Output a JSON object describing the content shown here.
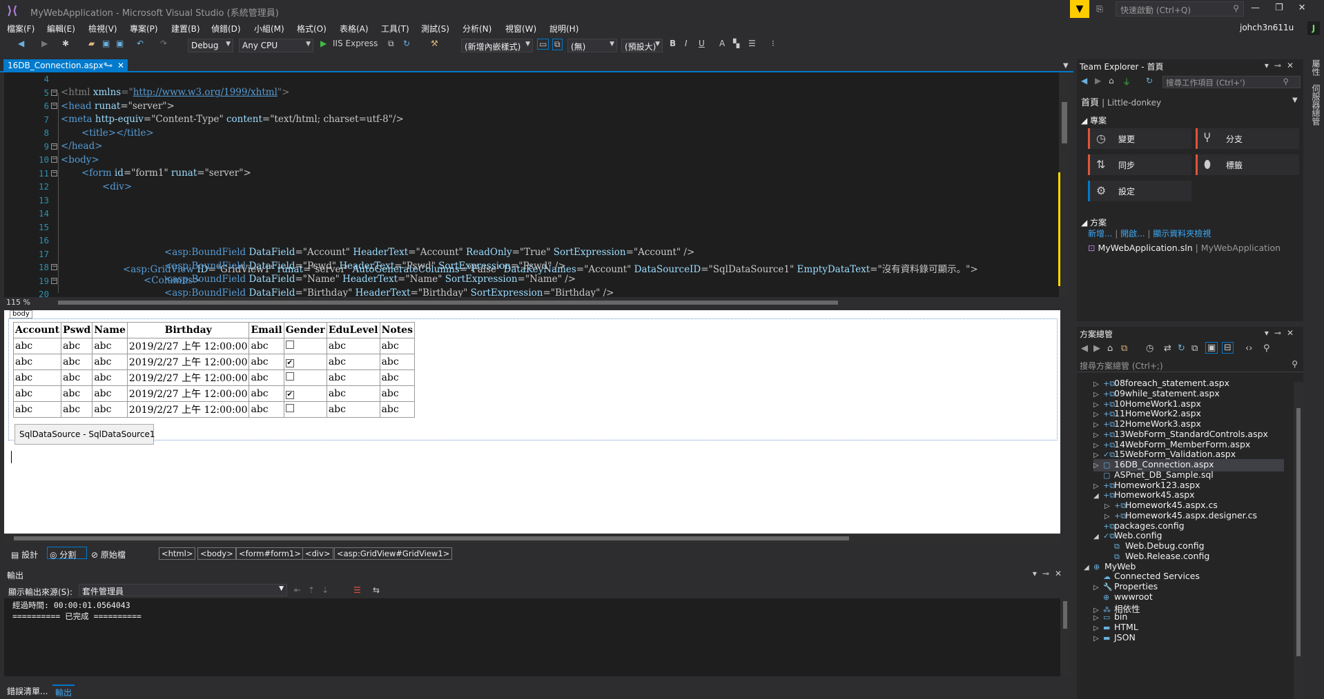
{
  "window": {
    "title": "MyWebApplication - Microsoft Visual Studio (系統管理員)",
    "quick_launch_placeholder": "快速啟動 (Ctrl+Q)",
    "user": "johch3n611u",
    "user_initial": "J"
  },
  "menu": [
    "檔案(F)",
    "編輯(E)",
    "檢視(V)",
    "專案(P)",
    "建置(B)",
    "偵錯(D)",
    "小組(M)",
    "格式(O)",
    "表格(A)",
    "工具(T)",
    "測試(S)",
    "分析(N)",
    "視窗(W)",
    "說明(H)"
  ],
  "toolbar": {
    "config": "Debug",
    "platform": "Any CPU",
    "run_label": "IIS Express",
    "style_combo": "(新增內嵌樣式)",
    "style_target": "(無)",
    "font_size": "(預設大)",
    "bold": "B",
    "italic": "I",
    "underline": "U"
  },
  "doc_tab": {
    "label": "16DB_Connection.aspx*"
  },
  "editor": {
    "zoom": "115 %",
    "line_numbers": [
      "4",
      "5",
      "6",
      "7",
      "8",
      "9",
      "10",
      "11",
      "12",
      "13",
      "14",
      "15",
      "16",
      "17",
      "18",
      "19",
      "20"
    ],
    "lines": {
      "l5a": "<html ",
      "l5b": "xmlns",
      "l5c": "=\"",
      "l5d": "http://www.w3.org/1999/xhtml",
      "l5e": "\">",
      "l6a": "<head ",
      "l6b": "runat",
      "l6c": "=\"server\">",
      "l7a": "<meta ",
      "l7b": "http-equiv",
      "l7c": "=\"Content-Type\" ",
      "l7d": "content",
      "l7e": "=\"text/html; charset=utf-8\"/>",
      "l8": "<title></title>",
      "l9": "</head>",
      "l10": "<body>",
      "l11a": "<form ",
      "l11b": "id",
      "l11c": "=\"form1\" ",
      "l11d": "runat",
      "l11e": "=\"server\">",
      "l12": "<div>",
      "l15a": "<asp:GridView ",
      "l15b": "ID",
      "l15c": "=\"GridView1\" ",
      "l15d": "runat",
      "l15e": "=\"server\" ",
      "l15f": "AutoGenerateColumns",
      "l15g": "=\"False\" ",
      "l15h": "DataKeyNames",
      "l15i": "=\"Account\" ",
      "l15j": "DataSourceID",
      "l15k": "=\"SqlDataSource1\" ",
      "l15l": "EmptyDataText",
      "l15m": "=\"沒有資料錄可顯示。\">",
      "l16": "<Columns>",
      "l17a": "<asp:BoundField ",
      "l17b": "DataField",
      "l17c": "=\"Account\" ",
      "l17d": "HeaderText",
      "l17e": "=\"Account\" ",
      "l17f": "ReadOnly",
      "l17g": "=\"True\" ",
      "l17h": "SortExpression",
      "l17i": "=\"Account\" />",
      "l18a": "<asp:BoundField ",
      "l18b": "DataField",
      "l18c": "=\"Pswd\" ",
      "l18d": "HeaderText",
      "l18e": "=\"Pswd\" ",
      "l18f": "SortExpression",
      "l18g": "=\"Pswd\" />",
      "l19a": "<asp:BoundField ",
      "l19b": "DataField",
      "l19c": "=\"Name\" ",
      "l19d": "HeaderText",
      "l19e": "=\"Name\" ",
      "l19f": "SortExpression",
      "l19g": "=\"Name\" />",
      "l20a": "<asp:BoundField ",
      "l20b": "DataField",
      "l20c": "=\"Birthday\" ",
      "l20d": "HeaderText",
      "l20e": "=\"Birthday\" ",
      "l20f": "SortExpression",
      "l20g": "=\"Birthday\" />"
    }
  },
  "design": {
    "body_tag": "body",
    "grid_headers": [
      "Account",
      "Pswd",
      "Name",
      "Birthday",
      "Email",
      "Gender",
      "EduLevel",
      "Notes"
    ],
    "grid_rows": [
      [
        "abc",
        "abc",
        "abc",
        "2019/2/27 上午 12:00:00",
        "abc",
        "",
        "abc",
        "abc"
      ],
      [
        "abc",
        "abc",
        "abc",
        "2019/2/27 上午 12:00:00",
        "abc",
        "✔",
        "abc",
        "abc"
      ],
      [
        "abc",
        "abc",
        "abc",
        "2019/2/27 上午 12:00:00",
        "abc",
        "",
        "abc",
        "abc"
      ],
      [
        "abc",
        "abc",
        "abc",
        "2019/2/27 上午 12:00:00",
        "abc",
        "✔",
        "abc",
        "abc"
      ],
      [
        "abc",
        "abc",
        "abc",
        "2019/2/27 上午 12:00:00",
        "abc",
        "",
        "abc",
        "abc"
      ]
    ],
    "datasource_label": "SqlDataSource - SqlDataSource1"
  },
  "viewbar": {
    "design": "設計",
    "split": "分割",
    "source": "原始檔",
    "crumbs": [
      "<html>",
      "<body>",
      "<form#form1>",
      "<div>",
      "<asp:GridView#GridView1>"
    ]
  },
  "output": {
    "title": "輸出",
    "source_label": "顯示輸出來源(S):",
    "source_value": "套件管理員",
    "text": "經過時間: 00:00:01.0564043\n========== 已完成 =========="
  },
  "bottom_tabs": [
    "錯誤清單...",
    "輸出"
  ],
  "team_explorer": {
    "title": "Team Explorer - 首頁",
    "search_placeholder": "搜尋工作項目 (Ctrl+')",
    "home": "首頁",
    "project": "Little-donkey",
    "section_project": "專案",
    "tiles": [
      "變更",
      "分支",
      "同步",
      "標籤",
      "設定"
    ],
    "tile_colors": [
      "#e0553b",
      "#e0553b",
      "#e0553b",
      "#e0553b",
      "#007acc"
    ],
    "section_solution": "方案",
    "links": [
      "新增...",
      "開啟...",
      "顯示資料夾檢視"
    ],
    "solution_name": "MyWebApplication.sln",
    "solution_path": "MyWebApplication"
  },
  "solution_explorer": {
    "title": "方案總管",
    "search_placeholder": "搜尋方案總管 (Ctrl+;)",
    "items": [
      {
        "label": "08foreach_statement.aspx",
        "exp": "▷",
        "icon": "+⧉"
      },
      {
        "label": "09while_statement.aspx",
        "exp": "▷",
        "icon": "+⧉"
      },
      {
        "label": "10HomeWork1.aspx",
        "exp": "▷",
        "icon": "+⧉"
      },
      {
        "label": "11HomeWork2.aspx",
        "exp": "▷",
        "icon": "+⧉"
      },
      {
        "label": "12HomeWork3.aspx",
        "exp": "▷",
        "icon": "+⧉"
      },
      {
        "label": "13WebForm_StandardControls.aspx",
        "exp": "▷",
        "icon": "+⧉"
      },
      {
        "label": "14WebForm_MemberForm.aspx",
        "exp": "▷",
        "icon": "+⧉"
      },
      {
        "label": "15WebForm_Validation.aspx",
        "exp": "▷",
        "icon": "✓⧉"
      },
      {
        "label": "16DB_Connection.aspx",
        "exp": "▷",
        "icon": "▢",
        "sel": true
      },
      {
        "label": "ASPnet_DB_Sample.sql",
        "exp": "",
        "icon": "▢"
      },
      {
        "label": "Homework123.aspx",
        "exp": "▷",
        "icon": "+⧉"
      },
      {
        "label": "Homework45.aspx",
        "exp": "◢",
        "icon": "+⧉"
      },
      {
        "label": "Homework45.aspx.cs",
        "exp": "▷",
        "icon": "+⧉",
        "indent": 1
      },
      {
        "label": "Homework45.aspx.designer.cs",
        "exp": "▷",
        "icon": "+⧉",
        "indent": 1
      },
      {
        "label": "packages.config",
        "exp": "",
        "icon": "+⧉"
      },
      {
        "label": "Web.config",
        "exp": "◢",
        "icon": "✓⧉"
      },
      {
        "label": "Web.Debug.config",
        "exp": "",
        "icon": "⧉",
        "indent": 1
      },
      {
        "label": "Web.Release.config",
        "exp": "",
        "icon": "⧉",
        "indent": 1
      },
      {
        "label": "MyWeb",
        "exp": "◢",
        "icon": "⊕",
        "indent": -1
      },
      {
        "label": "Connected Services",
        "exp": "",
        "icon": "☁"
      },
      {
        "label": "Properties",
        "exp": "▷",
        "icon": "🔧"
      },
      {
        "label": "wwwroot",
        "exp": "",
        "icon": "⊕"
      },
      {
        "label": "相依性",
        "exp": "▷",
        "icon": "⁂"
      },
      {
        "label": "bin",
        "exp": "▷",
        "icon": "▭"
      },
      {
        "label": "HTML",
        "exp": "▷",
        "icon": "▬"
      },
      {
        "label": "JSON",
        "exp": "▷",
        "icon": "▬"
      }
    ]
  },
  "right_rail": [
    "屬性",
    "伺服器總管"
  ]
}
